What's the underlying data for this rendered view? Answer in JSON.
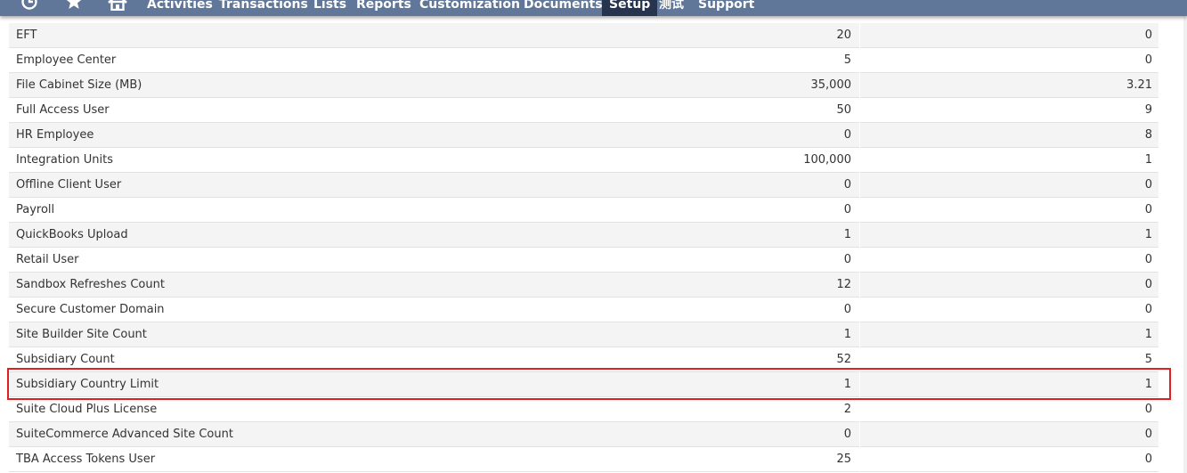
{
  "nav": {
    "items": [
      "Activities",
      "Transactions",
      "Lists",
      "Reports",
      "Customization",
      "Documents",
      "Setup",
      "测试",
      "Support"
    ],
    "active": "Setup",
    "icons": [
      "recent-records-icon",
      "shortcuts-star-icon",
      "home-icon"
    ]
  },
  "table": {
    "rows": [
      {
        "name": "EFT",
        "limit": "20",
        "used": "0"
      },
      {
        "name": "Employee Center",
        "limit": "5",
        "used": "0"
      },
      {
        "name": "File Cabinet Size (MB)",
        "limit": "35,000",
        "used": "3.21"
      },
      {
        "name": "Full Access User",
        "limit": "50",
        "used": "9"
      },
      {
        "name": "HR Employee",
        "limit": "0",
        "used": "8"
      },
      {
        "name": "Integration Units",
        "limit": "100,000",
        "used": "1"
      },
      {
        "name": "Offline Client User",
        "limit": "0",
        "used": "0"
      },
      {
        "name": "Payroll",
        "limit": "0",
        "used": "0"
      },
      {
        "name": "QuickBooks Upload",
        "limit": "1",
        "used": "1"
      },
      {
        "name": "Retail User",
        "limit": "0",
        "used": "0"
      },
      {
        "name": "Sandbox Refreshes Count",
        "limit": "12",
        "used": "0"
      },
      {
        "name": "Secure Customer Domain",
        "limit": "0",
        "used": "0"
      },
      {
        "name": "Site Builder Site Count",
        "limit": "1",
        "used": "1"
      },
      {
        "name": "Subsidiary Count",
        "limit": "52",
        "used": "5"
      },
      {
        "name": "Subsidiary Country Limit",
        "limit": "1",
        "used": "1"
      },
      {
        "name": "Suite Cloud Plus License",
        "limit": "2",
        "used": "0"
      },
      {
        "name": "SuiteCommerce Advanced Site Count",
        "limit": "0",
        "used": "0"
      },
      {
        "name": "TBA Access Tokens User",
        "limit": "25",
        "used": "0"
      }
    ]
  },
  "colors": {
    "navbar": "#607799",
    "active_tab": "#27344f",
    "highlight_border": "#e02020"
  }
}
